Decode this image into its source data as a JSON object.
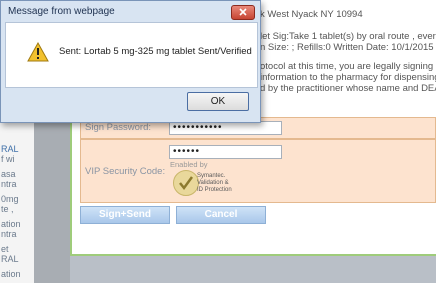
{
  "left_panel": {
    "fragments": [
      {
        "text": "RAL",
        "blue": true
      },
      {
        "text": "f wi",
        "blue": false
      },
      {
        "text": "asa",
        "blue": false
      },
      {
        "text": "ntra",
        "blue": false
      },
      {
        "text": "0mg",
        "blue": false
      },
      {
        "text": "te ,",
        "blue": false
      },
      {
        "text": "ation",
        "blue": false
      },
      {
        "text": "ntra",
        "blue": false
      },
      {
        "text": "et",
        "blue": false
      },
      {
        "text": "RAL",
        "blue": false
      },
      {
        "text": "ation",
        "blue": false
      }
    ]
  },
  "background_text": {
    "line1": "k West Nyack NY 10994",
    "line2": "let Sig:Take 1 tablet(s) by oral route , every",
    "line3": "n Size: ; Refills:0 Written Date: 10/1/2015",
    "line4": "otocol at this time, you are legally signing the",
    "line5": "information to the pharmacy for dispensing.",
    "line6": "d by the practitioner whose name and DEA re"
  },
  "form": {
    "sign_password_label": "Sign Password:",
    "sign_password_value": "•••••••••••",
    "vip_label": "VIP Security Code:",
    "vip_value": "••••••",
    "enabled_by": "Enabled by",
    "badge_line1": "Symantec.",
    "badge_line2": "Validation &",
    "badge_line3": "ID Protection",
    "sign_send_label": "Sign+Send",
    "cancel_label": "Cancel"
  },
  "dialog": {
    "title": "Message from webpage",
    "message": "Sent: Lortab 5 mg-325 mg tablet Sent/Verified",
    "ok_label": "OK"
  }
}
